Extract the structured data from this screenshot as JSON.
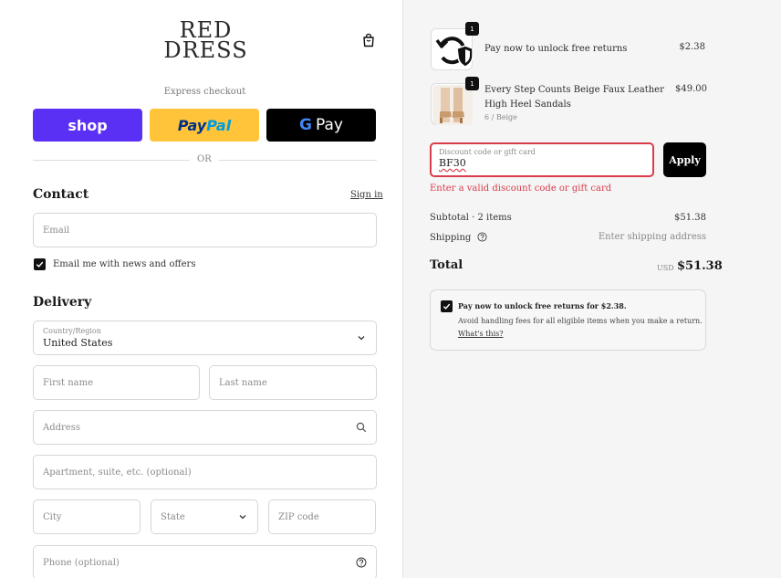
{
  "brand": {
    "line1": "RED",
    "line2": "DRESS"
  },
  "express": {
    "label": "Express checkout",
    "shop": "shop",
    "paypal_a": "Pay",
    "paypal_b": "Pal",
    "gpay_g": "G",
    "gpay_text": "Pay",
    "or": "OR"
  },
  "contact": {
    "title": "Contact",
    "signin": "Sign in",
    "email_placeholder": "Email",
    "newsletter_label": "Email me with news and offers",
    "newsletter_checked": true
  },
  "delivery": {
    "title": "Delivery",
    "country_label": "Country/Region",
    "country_value": "United States",
    "first_name": "First name",
    "last_name": "Last name",
    "address": "Address",
    "apartment": "Apartment, suite, etc. (optional)",
    "city": "City",
    "state": "State",
    "zip": "ZIP code",
    "phone": "Phone (optional)"
  },
  "cart": {
    "items": [
      {
        "name": "Pay now to unlock free returns",
        "variant": "",
        "price": "$2.38",
        "qty": "1",
        "icon": "returns-shield-icon"
      },
      {
        "name": "Every Step Counts Beige Faux Leather High Heel Sandals",
        "variant": "6 / Beige",
        "price": "$49.00",
        "qty": "1",
        "icon": "sandals-image"
      }
    ]
  },
  "discount": {
    "label": "Discount code or gift card",
    "value": "BF30",
    "apply": "Apply",
    "error": "Enter a valid discount code or gift card"
  },
  "summary": {
    "subtotal_label": "Subtotal",
    "subtotal_items": "· 2 items",
    "subtotal_value": "$51.38",
    "shipping_label": "Shipping",
    "shipping_value": "Enter shipping address",
    "total_label": "Total",
    "currency": "USD",
    "total_value": "$51.38"
  },
  "returns_offer": {
    "title": "Pay now to unlock free returns for $2.38.",
    "description": "Avoid handling fees for all eligible items when you make a return.",
    "link": "What's this?",
    "checked": true
  },
  "colors": {
    "shop_purple": "#5a31f4",
    "paypal_yellow": "#ffc439",
    "error_red": "#d93c4a",
    "summary_bg": "#f5f5f5"
  }
}
